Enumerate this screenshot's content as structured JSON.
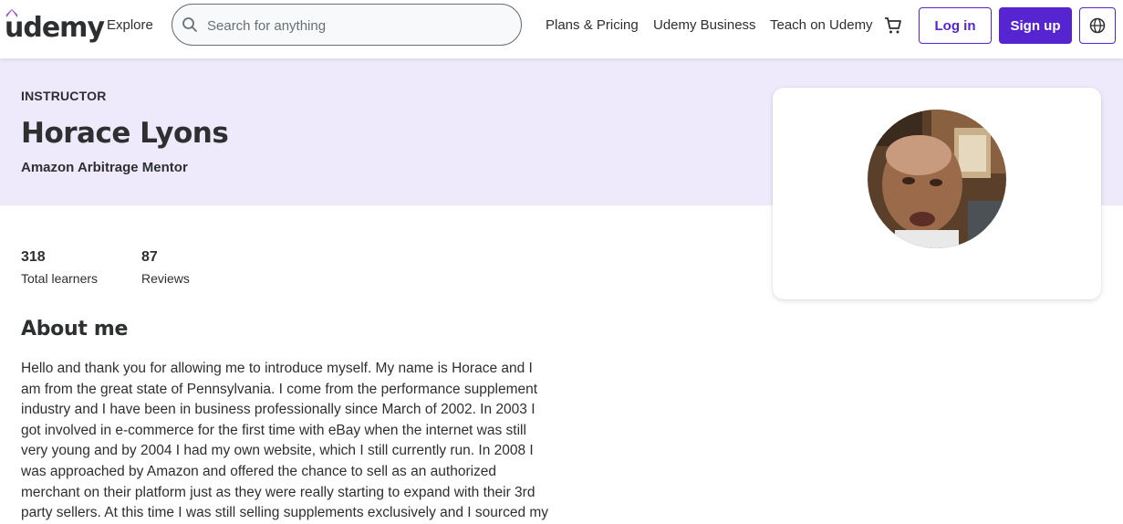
{
  "header": {
    "logo": "udemy",
    "explore": "Explore",
    "search_placeholder": "Search for anything",
    "plans_pricing": "Plans & Pricing",
    "udemy_business": "Udemy Business",
    "teach": "Teach on Udemy",
    "login": "Log in",
    "signup": "Sign up"
  },
  "instructor": {
    "label": "INSTRUCTOR",
    "name": "Horace Lyons",
    "headline": "Amazon Arbitrage Mentor"
  },
  "stats": [
    {
      "value": "318",
      "label": "Total learners"
    },
    {
      "value": "87",
      "label": "Reviews"
    }
  ],
  "about": {
    "title": "About me",
    "lines": [
      "Hello and thank you for allowing me to introduce myself.  My name is Horace and I",
      "am from the great state of Pennsylvania.  I come from the performance supplement",
      "industry and I have been in business professionally since March of 2002.  In 2003 I",
      "got involved in e-commerce for the first time with eBay when the internet was still",
      "very young and by 2004 I had my own website, which I still currently run.  In 2008 I",
      "was approached by Amazon and offered the chance to sell as an authorized",
      "merchant on their platform just as they were really starting to expand with their 3rd",
      "party sellers. At this time I was still selling supplements exclusively and I sourced my"
    ]
  },
  "colors": {
    "brand": "#5624d0",
    "banner": "#eeeafc",
    "text": "#2d2f31"
  }
}
